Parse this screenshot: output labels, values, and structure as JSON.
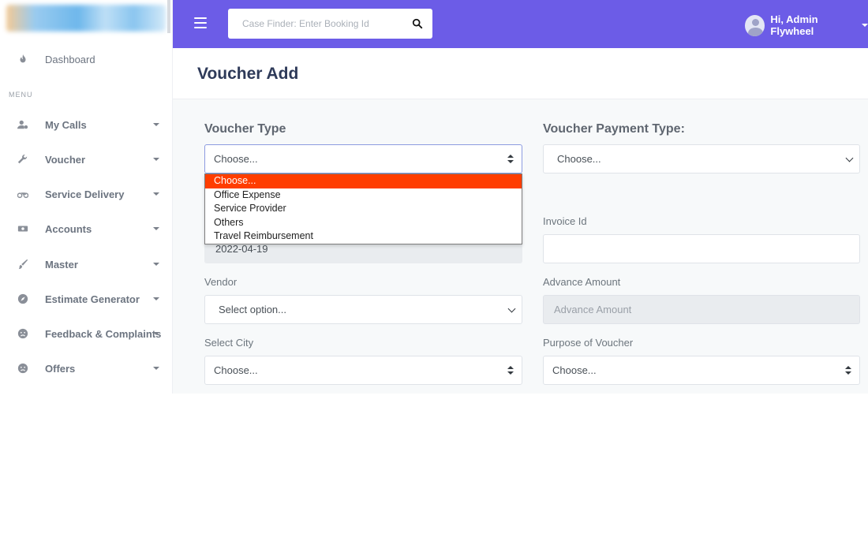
{
  "sidebar": {
    "menu_heading": "MENU",
    "items": [
      {
        "label": "Dashboard",
        "icon": "fire-icon"
      },
      {
        "label": "My Calls",
        "icon": "user-cog-icon"
      },
      {
        "label": "Voucher",
        "icon": "wrench-icon"
      },
      {
        "label": "Service Delivery",
        "icon": "motorcycle-icon"
      },
      {
        "label": "Accounts",
        "icon": "money-bill-icon"
      },
      {
        "label": "Master",
        "icon": "brush-icon"
      },
      {
        "label": "Estimate Generator",
        "icon": "compass-icon"
      },
      {
        "label": "Feedback & Complaints",
        "icon": "frown-icon"
      },
      {
        "label": "Offers",
        "icon": "frown-icon"
      }
    ]
  },
  "topbar": {
    "search_placeholder": "Case Finder: Enter Booking Id",
    "user_greeting": "Hi, Admin Flywheel",
    "accent": "#6c5ce7"
  },
  "page": {
    "title": "Voucher Add"
  },
  "form": {
    "voucher_type_title": "Voucher Type",
    "voucher_type_value": "Choose...",
    "voucher_type_options": [
      "Choose...",
      "Office Expense",
      "Service Provider",
      "Others",
      "Travel Reimbursement"
    ],
    "voucher_type_selected_index": 0,
    "payment_type_title": "Voucher Payment Type:",
    "payment_type_value": "Choose...",
    "date_value": "2022-04-19",
    "invoice_label": "Invoice Id",
    "invoice_value": "",
    "vendor_label": "Vendor",
    "vendor_value": "Select option...",
    "advance_label": "Advance Amount",
    "advance_placeholder": "Advance Amount",
    "city_label": "Select City",
    "city_value": "Choose...",
    "purpose_label": "Purpose of Voucher",
    "purpose_value": "Choose..."
  },
  "colors": {
    "option_highlight": "#ff3d00"
  }
}
